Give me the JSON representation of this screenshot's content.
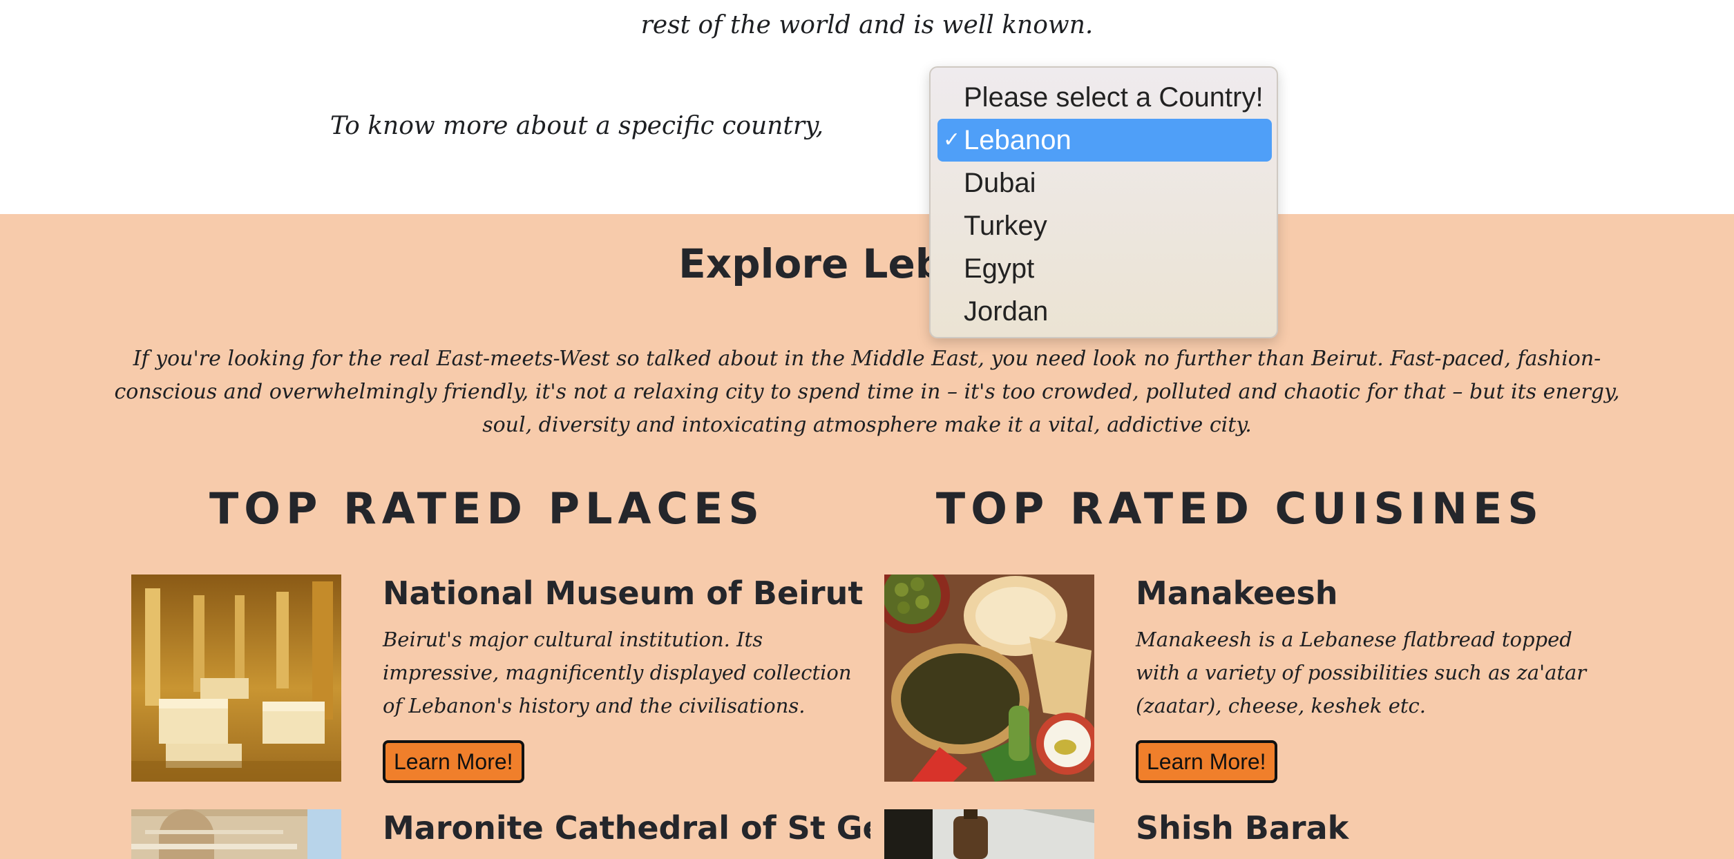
{
  "intro": {
    "line1": "rest of the world and is well known.",
    "line2": "To know more about a specific country,"
  },
  "country_select": {
    "placeholder": "Please select a Country!",
    "selected": "Lebanon",
    "options": [
      "Lebanon",
      "Dubai",
      "Turkey",
      "Egypt",
      "Jordan"
    ]
  },
  "explore": {
    "title": "Explore Lebanon",
    "description": "If you're looking for the real East-meets-West so talked about in the Middle East, you need look no further than Beirut. Fast-paced, fashion-conscious and overwhelmingly friendly, it's not a relaxing city to spend time in – it's too crowded, polluted and chaotic for that – but its energy, soul, diversity and intoxicating atmosphere make it a vital, addictive city."
  },
  "places": {
    "heading": "TOP RATED PLACES",
    "items": [
      {
        "title": "National Museum of Beirut",
        "description": "Beirut's major cultural institution. Its impressive, magnificently displayed collection of Lebanon's history and the civilisations.",
        "button": "Learn More!"
      },
      {
        "title": "Maronite Cathedral of St George"
      }
    ]
  },
  "cuisines": {
    "heading": "TOP RATED CUISINES",
    "items": [
      {
        "title": "Manakeesh",
        "description": "Manakeesh is a Lebanese flatbread topped with a variety of possibilities such as za'atar (zaatar), cheese, keshek etc.",
        "button": "Learn More!"
      },
      {
        "title": "Shish Barak"
      }
    ]
  },
  "colors": {
    "section_bg": "#f7cbab",
    "button_bg": "#f07f2b",
    "selected_option": "#4f9ff8"
  }
}
